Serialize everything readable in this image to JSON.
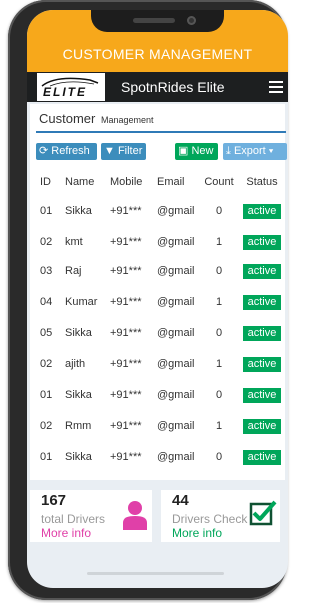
{
  "header": {
    "title": "CUSTOMER MANAGEMENT"
  },
  "navbar": {
    "logo_text": "ELITE",
    "app_name": "SpotnRides Elite"
  },
  "page": {
    "heading": "Customer",
    "heading_sub": "Management"
  },
  "toolbar": {
    "refresh": "Refresh",
    "filter": "Filter",
    "new": "New",
    "export": "Export"
  },
  "table": {
    "columns": [
      "ID",
      "Name",
      "Mobile",
      "Email",
      "Count",
      "Status"
    ],
    "rows": [
      {
        "id": "01",
        "name": "Sikka",
        "mobile": "+91***",
        "email": "@gmail",
        "count": "0",
        "status": "active"
      },
      {
        "id": "02",
        "name": "kmt",
        "mobile": "+91***",
        "email": "@gmail",
        "count": "1",
        "status": "active"
      },
      {
        "id": "03",
        "name": "Raj",
        "mobile": "+91***",
        "email": "@gmail",
        "count": "0",
        "status": "active"
      },
      {
        "id": "04",
        "name": "Kumar",
        "mobile": "+91***",
        "email": "@gmail",
        "count": "1",
        "status": "active"
      },
      {
        "id": "05",
        "name": "Sikka",
        "mobile": "+91***",
        "email": "@gmail",
        "count": "0",
        "status": "active"
      },
      {
        "id": "02",
        "name": "ajith",
        "mobile": "+91***",
        "email": "@gmail",
        "count": "1",
        "status": "active"
      },
      {
        "id": "01",
        "name": "Sikka",
        "mobile": "+91***",
        "email": "@gmail",
        "count": "0",
        "status": "active"
      },
      {
        "id": "02",
        "name": "Rmm",
        "mobile": "+91***",
        "email": "@gmail",
        "count": "1",
        "status": "active"
      },
      {
        "id": "01",
        "name": "Sikka",
        "mobile": "+91***",
        "email": "@gmail",
        "count": "0",
        "status": "active"
      }
    ]
  },
  "stats": [
    {
      "value": "167",
      "label": "total Drivers",
      "link": "More info"
    },
    {
      "value": "44",
      "label": "Drivers Check",
      "link": "More info"
    }
  ],
  "colors": {
    "header": "#f7a81b",
    "navbar": "#1d1f20",
    "primary_button": "#3c8dbc",
    "success": "#00a65a",
    "accent_pink": "#e040a8"
  }
}
